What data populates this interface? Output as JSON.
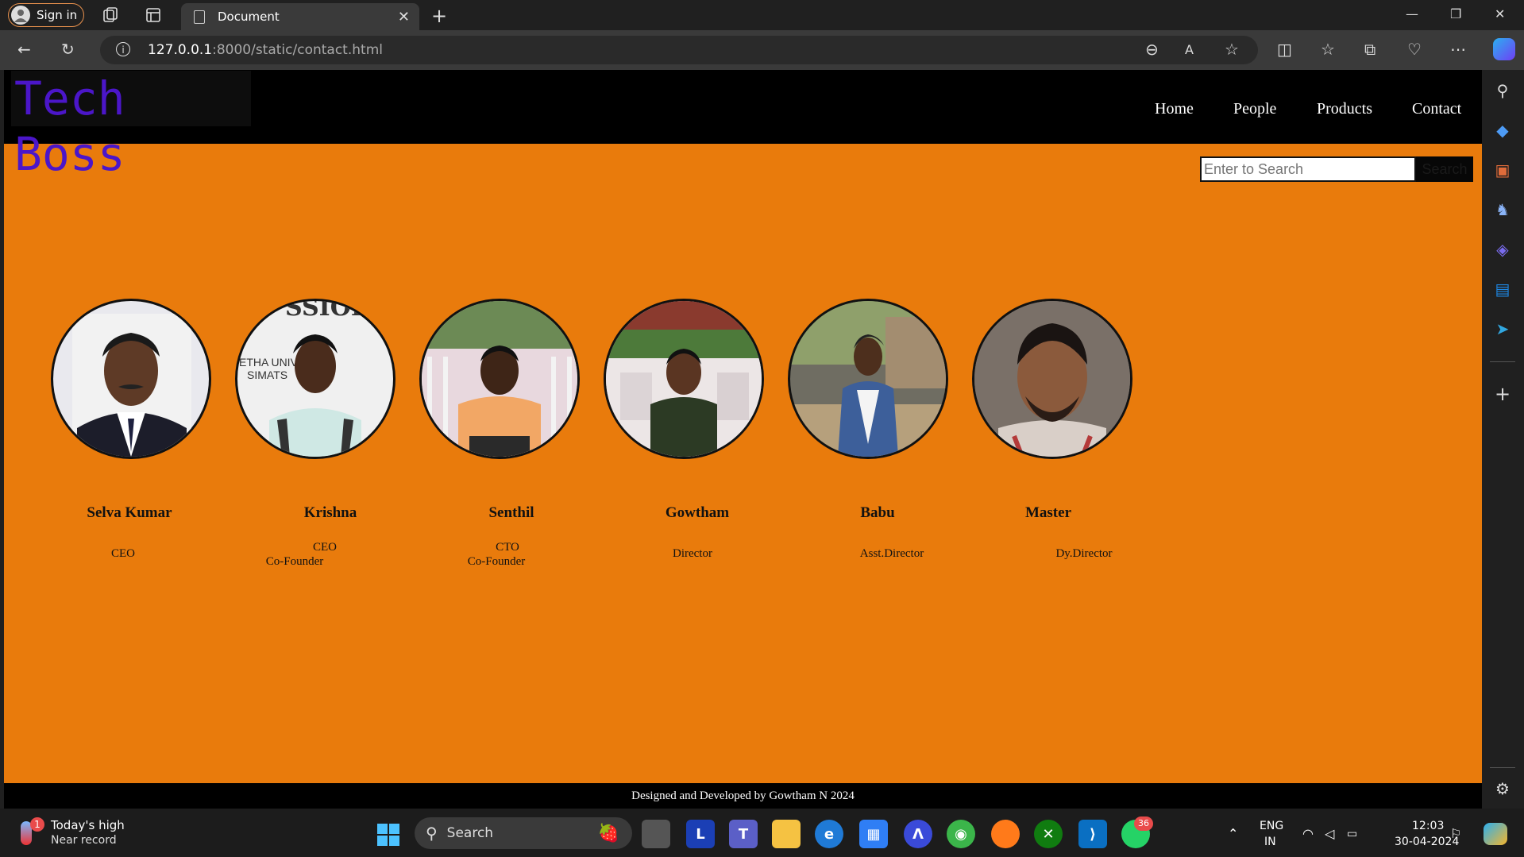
{
  "browser": {
    "signin_label": "Sign in",
    "tab_title": "Document",
    "url_host": "127.0.0.1",
    "url_path": ":8000/static/contact.html"
  },
  "site": {
    "logo": "Tech Boss",
    "nav": [
      "Home",
      "People",
      "Products",
      "Contact"
    ],
    "search_placeholder": "Enter to Search",
    "search_button": "Search",
    "people": [
      {
        "name": "Selva Kumar",
        "role1": "CEO",
        "role2": ""
      },
      {
        "name": "Krishna",
        "role1": "CEO",
        "role2": "Co-Founder"
      },
      {
        "name": "Senthil",
        "role1": "CTO",
        "role2": "Co-Founder"
      },
      {
        "name": "Gowtham",
        "role1": "Director",
        "role2": ""
      },
      {
        "name": "Babu",
        "role1": "Asst.Director",
        "role2": ""
      },
      {
        "name": "Master",
        "role1": "Dy.Director",
        "role2": ""
      }
    ],
    "photo_text": {
      "banner": "SSIOI",
      "uni": "ETHA UNIVE",
      "simats": "SIMATS"
    },
    "footer": "Designed and Developed by Gowtham N 2024"
  },
  "taskbar": {
    "weather_badge": "1",
    "weather_title": "Today's high",
    "weather_sub": "Near record",
    "search_label": "Search",
    "whatsapp_badge": "36",
    "lang1": "ENG",
    "lang2": "IN",
    "time": "12:03",
    "date": "30-04-2024",
    "app_letter": "L"
  },
  "colors": {
    "page_bg": "#e97b0c",
    "logo": "#4b16c9",
    "header": "#000000"
  }
}
